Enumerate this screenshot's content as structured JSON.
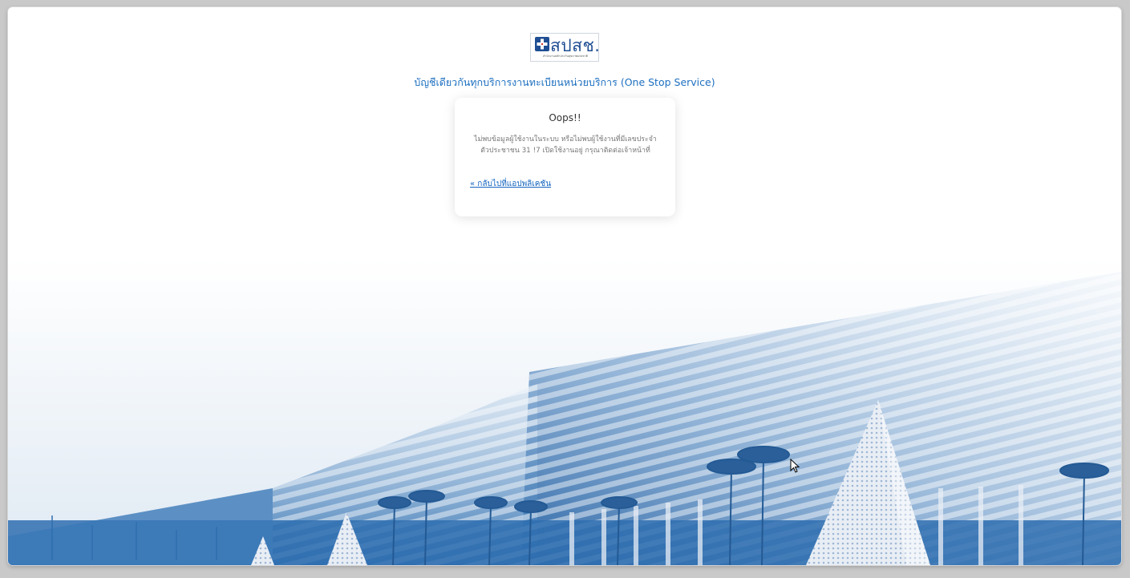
{
  "logo": {
    "brand": "สปสช.",
    "subtitle": "สำนักงานหลักประกันสุขภาพแห่งชาติ"
  },
  "header": {
    "service_title": "บัญชีเดียวกันทุกบริการงานทะเบียนหน่วยบริการ (One Stop Service)"
  },
  "card": {
    "title": "Oops!!",
    "message": "ไม่พบข้อมูลผู้ใช้งานในระบบ หรือไม่พบผู้ใช้งานที่มีเลขประจำตัวประชาชน 31 !7 เปิดใช้งานอยู่ กรุณาติดต่อเจ้าหน้าที่",
    "back_link": "« กลับไปที่แอปพลิเคชัน"
  },
  "colors": {
    "accent": "#1d6fc0",
    "link": "#1565c0",
    "building_blue": "#2f6fb0"
  }
}
